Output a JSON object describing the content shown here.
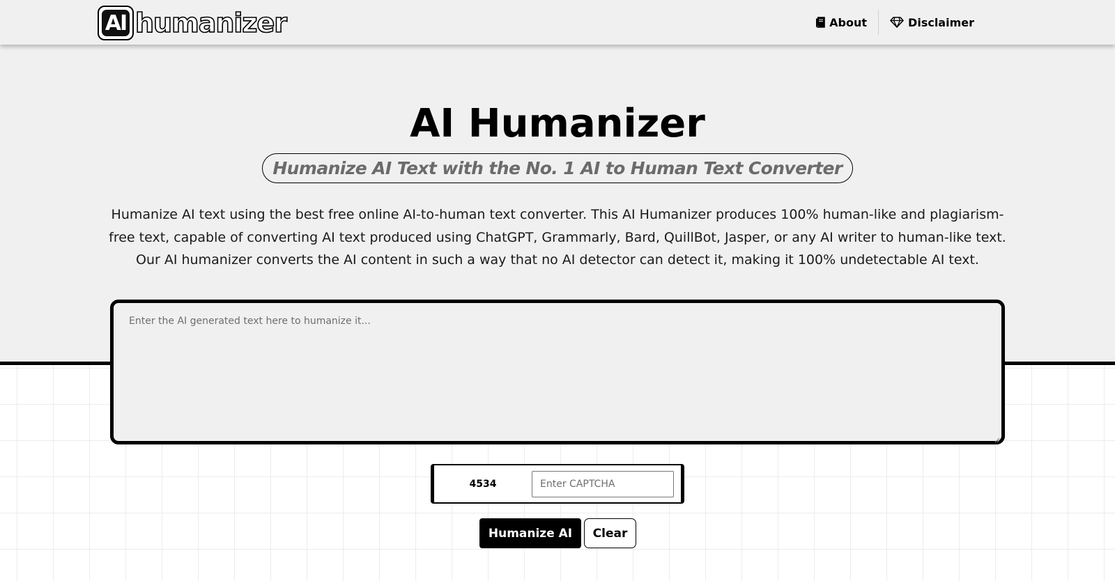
{
  "logo": {
    "badge_text": "AI",
    "wordmark": "humanizer"
  },
  "nav": {
    "items": [
      {
        "label": "About",
        "icon": "book-icon"
      },
      {
        "label": "Disclaimer",
        "icon": "diamond-icon"
      }
    ]
  },
  "hero": {
    "title": "AI Humanizer",
    "subtitle": "Humanize AI Text with the No. 1 AI to Human Text Converter",
    "description": "Humanize AI text using the best free online AI-to-human text converter. This AI Humanizer produces 100% human-like and plagiarism-free text, capable of converting AI text produced using ChatGPT, Grammarly, Bard, QuillBot, Jasper, or any AI writer to human-like text. Our AI humanizer converts the AI content in such a way that no AI detector can detect it, making it 100% undetectable AI text."
  },
  "editor": {
    "value": "",
    "placeholder": "Enter the AI generated text here to humanize it..."
  },
  "captcha": {
    "code": "4534",
    "value": "",
    "placeholder": "Enter CAPTCHA"
  },
  "actions": {
    "humanize_label": "Humanize AI",
    "clear_label": "Clear"
  },
  "colors": {
    "background": "#f0f0f0",
    "accent": "#000000",
    "subtitle": "#6b6b6b",
    "grid": "#ececec"
  }
}
